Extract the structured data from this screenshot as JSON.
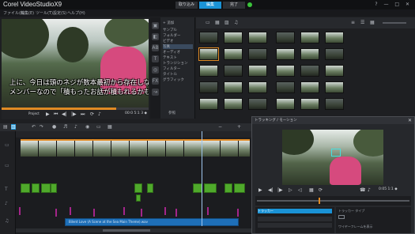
{
  "app": {
    "title": "Corel VideoStudioX9"
  },
  "steps": [
    {
      "label": "取り込み",
      "active": false
    },
    {
      "label": "編集",
      "active": true
    },
    {
      "label": "完了",
      "active": false
    }
  ],
  "window_controls": "? — □ ✕",
  "menu": [
    "ファイル(F)",
    "編集(E)",
    "ツール(T)",
    "設定(S)",
    "ヘルプ(H)"
  ],
  "player": {
    "subtitle_line1": "上に、今日は頭のネジが数本最初から存在しない",
    "subtitle_line2": "メンバーなので「積もったお話が積もれるかも」",
    "progress": 0.78,
    "project_label": "Project",
    "timecode": "00:0 5:1 3 ◆"
  },
  "library": {
    "add_label": "+ 追加",
    "folders": [
      "サンプル",
      "フォルダー",
      "ビデオ",
      "写真",
      "オーディオ",
      "テキスト",
      "トランジション",
      "フィルター",
      "タイトル",
      "グラフィック"
    ],
    "browse_label": "参照"
  },
  "timeline": {
    "audio_clip_label": "Bilent Love (A Scene at the Sea Main Theme).wav",
    "playhead_fraction": 0.79
  },
  "preview_window": {
    "title": "トラッキング / モーション",
    "timecode": "0:05 1:1 ◆",
    "panel_rows": [
      "トラッカー",
      "",
      ""
    ],
    "panel2_rows": [
      "トラッカー タイプ",
      "",
      "ワイヤーフレームを表示"
    ]
  },
  "colors": {
    "accent": "#e08a24",
    "step_active": "#1a93d6",
    "clip_green": "#4fa92b",
    "audio_blue": "#1e6fb8",
    "overlay_magenta": "#a4258a"
  }
}
